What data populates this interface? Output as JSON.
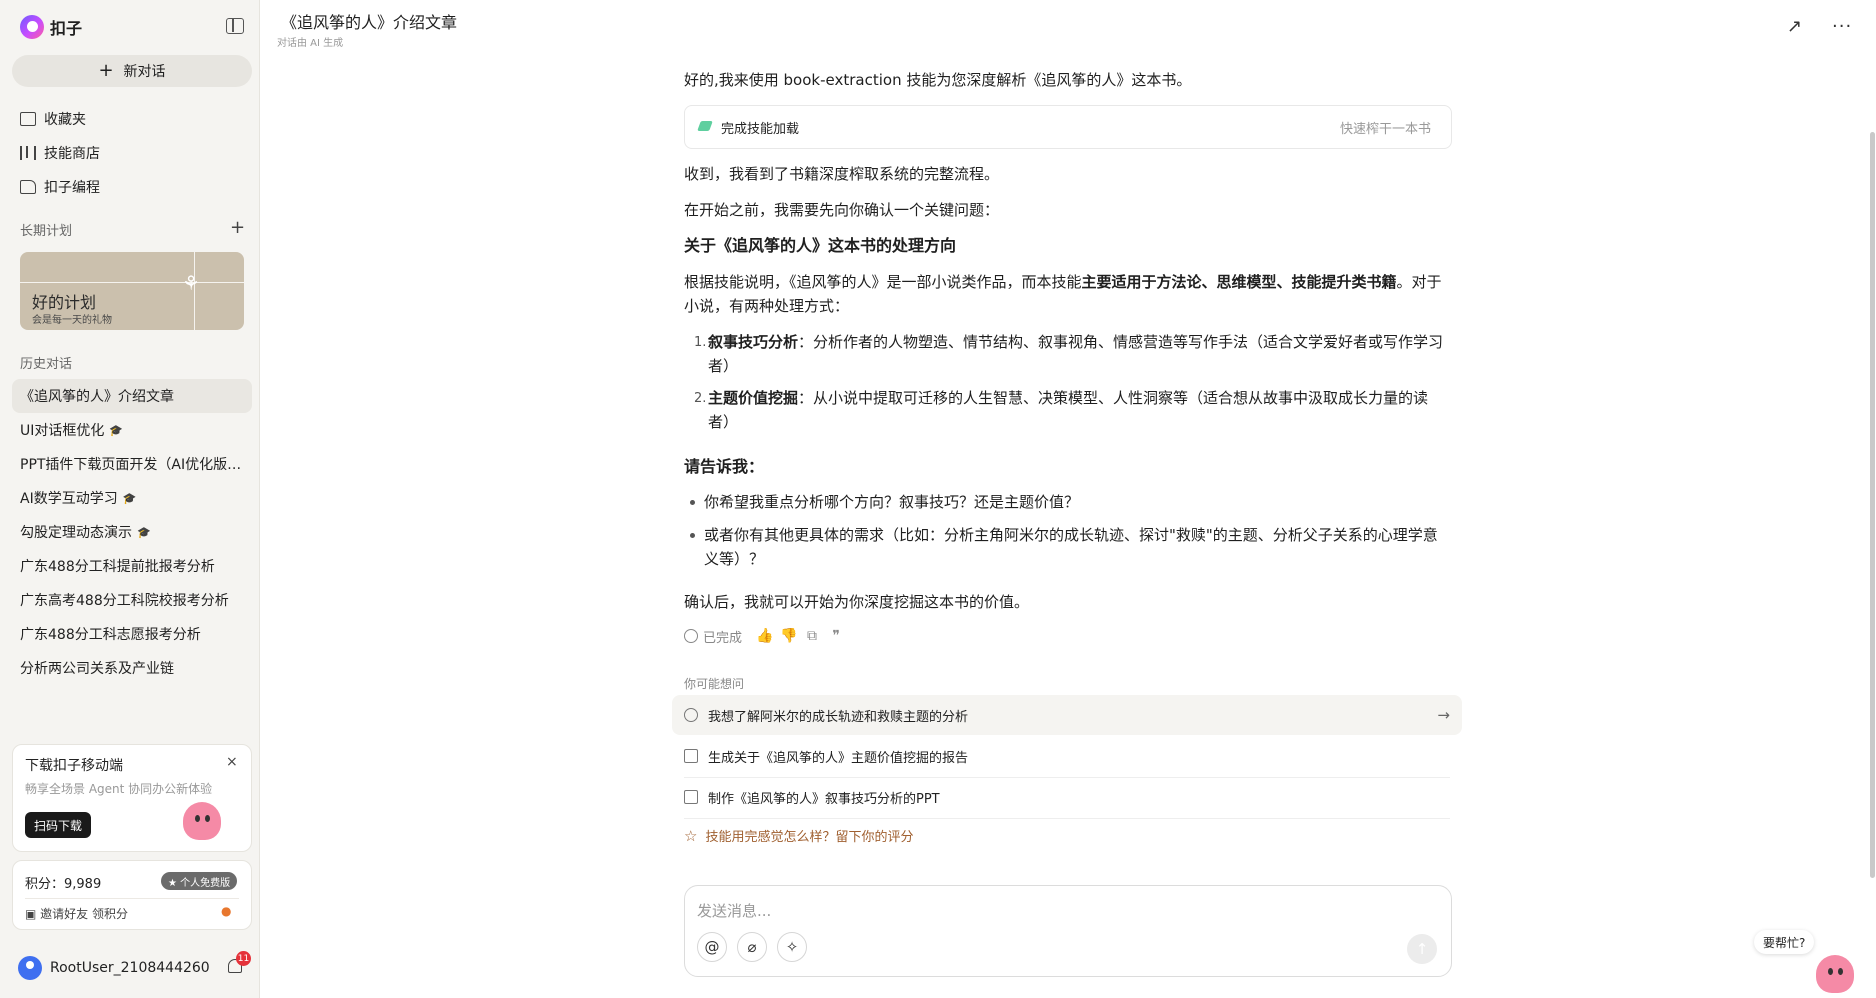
{
  "app": {
    "name": "扣子",
    "new_chat": "新对话"
  },
  "sidebar": {
    "nav": [
      {
        "label": "收藏夹",
        "icon": "folder-icon"
      },
      {
        "label": "技能商店",
        "icon": "books-icon"
      },
      {
        "label": "扣子编程",
        "icon": "code-icon"
      }
    ],
    "plan_section": "长期计划",
    "plan_card": {
      "title": "好的计划",
      "subtitle": "会是每一天的礼物"
    },
    "history_section": "历史对话",
    "history": [
      {
        "label": "《追风筝的人》介绍文章",
        "badge": ""
      },
      {
        "label": "UI对话框优化",
        "badge": "🎓"
      },
      {
        "label": "PPT插件下载页面开发（AI优化版…",
        "badge": ""
      },
      {
        "label": "AI数学互动学习",
        "badge": "🎓"
      },
      {
        "label": "勾股定理动态演示",
        "badge": "🎓"
      },
      {
        "label": "广东488分工科提前批报考分析",
        "badge": ""
      },
      {
        "label": "广东高考488分工科院校报考分析",
        "badge": ""
      },
      {
        "label": "广东488分工科志愿报考分析",
        "badge": ""
      },
      {
        "label": "分析两公司关系及产业链",
        "badge": ""
      }
    ],
    "promo": {
      "title": "下载扣子移动端",
      "subtitle": "畅享全场景 Agent 协同办公新体验",
      "button": "扫码下载",
      "close": "×"
    },
    "points": {
      "label": "积分：9,989",
      "badge": "★ 个人免费版",
      "invite": "邀请好友 领积分"
    },
    "user": {
      "name": "RootUser_2108444260",
      "notifications": "11"
    }
  },
  "header": {
    "title": "《追风筝的人》介绍文章",
    "subtitle": "对话由 AI 生成"
  },
  "conversation": {
    "intro": "好的,我来使用 book-extraction 技能为您深度解析《追风筝的人》这本书。",
    "skill": {
      "status": "完成技能加载",
      "name": "快速榨干一本书"
    },
    "p1": "收到，我看到了书籍深度榨取系统的完整流程。",
    "p2": "在开始之前，我需要先向你确认一个关键问题：",
    "heading1": "关于《追风筝的人》这本书的处理方向",
    "p3_a": "根据技能说明，《追风筝的人》是一部小说类作品，而本技能",
    "p3_bold": "主要适用于方法论、思维模型、技能提升类书籍",
    "p3_b": "。对于小说，有两种处理方式：",
    "options": [
      {
        "num": "1.",
        "bold": "叙事技巧分析",
        "text": "：分析作者的人物塑造、情节结构、叙事视角、情感营造等写作手法（适合文学爱好者或写作学习者）"
      },
      {
        "num": "2.",
        "bold": "主题价值挖掘",
        "text": "：从小说中提取可迁移的人生智慧、决策模型、人性洞察等（适合想从故事中汲取成长力量的读者）"
      }
    ],
    "heading2": "请告诉我：",
    "bullets": [
      "你希望我重点分析哪个方向？叙事技巧？还是主题价值？",
      "或者你有其他更具体的需求（比如：分析主角阿米尔的成长轨迹、探讨\"救赎\"的主题、分析父子关系的心理学意义等）？"
    ],
    "closing": "确认后，我就可以开始为你深度挖掘这本书的价值。",
    "status": "已完成"
  },
  "suggestions": {
    "label": "你可能想问",
    "items": [
      "我想了解阿米尔的成长轨迹和救赎主题的分析",
      "生成关于《追风筝的人》主题价值挖掘的报告",
      "制作《追风筝的人》叙事技巧分析的PPT"
    ],
    "rate": "技能用完感觉怎么样？留下你的评分"
  },
  "composer": {
    "placeholder": "发送消息..."
  },
  "help": {
    "label": "要帮忙?"
  }
}
